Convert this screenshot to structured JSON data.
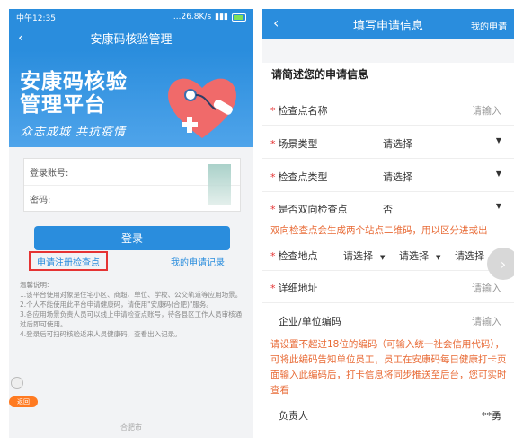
{
  "left": {
    "status_time": "中午12:35",
    "status_right": "...26.8K/s",
    "nav_title": "安康码核验管理",
    "banner_title_1": "安康码核验",
    "banner_title_2": "管理平台",
    "banner_slogan": "众志成城 共抗疫情",
    "account_label": "登录账号:",
    "password_label": "密码:",
    "login_button": "登录",
    "register_link": "申请注册检查点",
    "records_link": "我的申请记录",
    "notes_title": "温馨说明:",
    "notes": [
      "1.该平台使用对象是住宅小区、商超、单位、学校、公交轨道等应用场景。",
      "2.个人不能使用此平台申请健康码，请使用\"安康码(合肥)\"服务。",
      "3.各应用场景负责人员可以线上申请检查点账号，待各县区工作人员审核通过后即可使用。",
      "4.登录后可扫码核验返来人员健康码，查看出入记录。"
    ],
    "badge_label": "返回",
    "footer": "合肥市"
  },
  "right": {
    "nav_title": "填写申请信息",
    "nav_right": "我的申请",
    "section_title": "请简述您的申请信息",
    "required_mark": "*",
    "fields": {
      "checkpoint_name": {
        "label": "检查点名称",
        "placeholder": "请输入"
      },
      "scene_type": {
        "label": "场景类型",
        "value": "请选择"
      },
      "checkpoint_type": {
        "label": "检查点类型",
        "value": "请选择"
      },
      "bidirectional": {
        "label": "是否双向检查点",
        "value": "否"
      },
      "location": {
        "label": "检查地点",
        "selects": [
          "请选择",
          "请选择",
          "请选择"
        ]
      },
      "address": {
        "label": "详细地址",
        "placeholder": "请输入"
      },
      "org_code": {
        "label": "企业/单位编码",
        "placeholder": "请输入"
      },
      "person_in_charge": {
        "label": "负责人",
        "value": "**勇"
      }
    },
    "hint_bidirectional": "双向检查点会生成两个站点二维码，用以区分进或出",
    "hint_org_code": "请设置不超过18位的编码（可输入统一社会信用代码），可将此编码告知单位员工，员工在安康码每日健康打卡页面输入此编码后，打卡信息将同步推送至后台，您可实时查看"
  },
  "colors": {
    "primary": "#2a8ddd",
    "required": "#e53333",
    "hint": "#e86a35",
    "highlight_box": "#e53333"
  },
  "icons": [
    "back-arrow-icon",
    "dropdown-arrow-icon",
    "heart-stethoscope-icon",
    "battery-icon",
    "chevron-right-icon"
  ]
}
